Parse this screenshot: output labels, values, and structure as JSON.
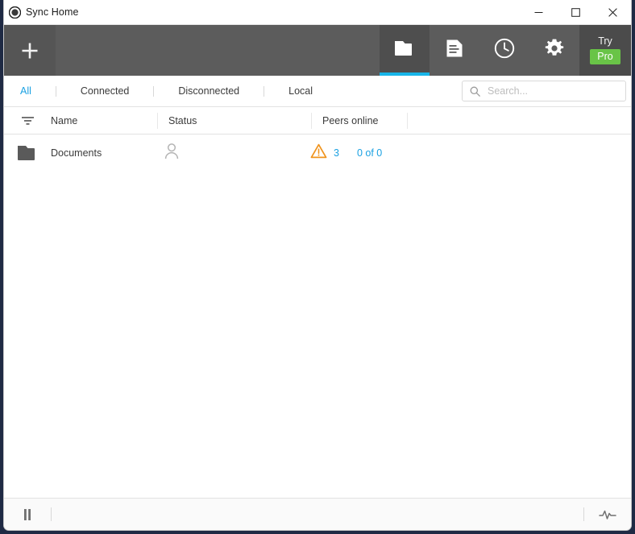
{
  "window": {
    "title": "Sync Home",
    "app_icon": "sync-logo-icon",
    "controls": {
      "minimize": "minimize-icon",
      "maximize": "maximize-icon",
      "close": "close-icon"
    }
  },
  "toolbar": {
    "add_label": "+",
    "tabs": [
      {
        "name": "folders",
        "icon": "folder-icon",
        "active": true
      },
      {
        "name": "devices",
        "icon": "document-list-icon",
        "active": false
      },
      {
        "name": "history",
        "icon": "clock-icon",
        "active": false
      },
      {
        "name": "settings",
        "icon": "gear-icon",
        "active": false
      }
    ],
    "try_label": "Try",
    "pro_label": "Pro",
    "active_accent": "#18b5e8",
    "pro_badge_color": "#69c447",
    "background": "#5c5c5c"
  },
  "filters": {
    "items": [
      {
        "label": "All",
        "active": true
      },
      {
        "label": "Connected",
        "active": false
      },
      {
        "label": "Disconnected",
        "active": false
      },
      {
        "label": "Local",
        "active": false
      }
    ],
    "active_color": "#1ba1e2"
  },
  "search": {
    "placeholder": "Search...",
    "value": "",
    "icon": "search-icon"
  },
  "table": {
    "sort_icon": "filter-sort-icon",
    "columns": [
      {
        "key": "name",
        "label": "Name"
      },
      {
        "key": "status",
        "label": "Status"
      },
      {
        "key": "peers",
        "label": "Peers online"
      }
    ],
    "rows": [
      {
        "icon": "folder-icon",
        "name": "Documents",
        "status_icon": "person-icon",
        "warning_icon": "warning-triangle-icon",
        "warning_count": "3",
        "peers": "0 of 0",
        "warning_color": "#f0941e",
        "link_color": "#1ba1e2"
      }
    ]
  },
  "status_bar": {
    "pause_icon": "pause-icon",
    "activity_icon": "activity-pulse-icon"
  }
}
